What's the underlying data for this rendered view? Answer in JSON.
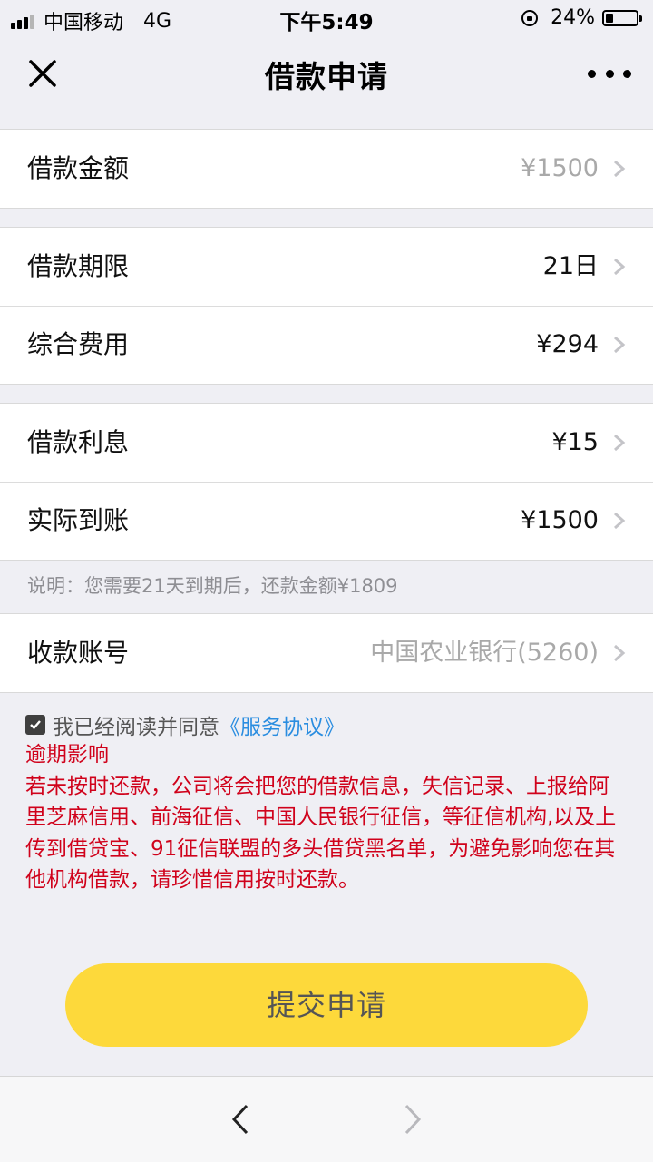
{
  "status_bar": {
    "carrier": "中国移动",
    "network": "4G",
    "time": "下午5:49",
    "battery": "24%",
    "battery_level": 0.24
  },
  "nav": {
    "title": "借款申请",
    "close_icon": "close-icon",
    "more_icon": "more-dots-icon"
  },
  "loan": {
    "amount": {
      "label": "借款金额",
      "value": "¥1500"
    },
    "term": {
      "label": "借款期限",
      "value": "21日"
    },
    "fee": {
      "label": "综合费用",
      "value": "¥294"
    },
    "interest": {
      "label": "借款利息",
      "value": "¥15"
    },
    "received": {
      "label": "实际到账",
      "value": "¥1500"
    },
    "note": "说明：您需要21天到期后，还款金额¥1809",
    "account": {
      "label": "收款账号",
      "value": "中国农业银行(5260)"
    }
  },
  "agreement": {
    "checked": true,
    "text": "我已经阅读并同意",
    "link": "《服务协议》"
  },
  "warning": {
    "title": "逾期影响",
    "body": "若未按时还款，公司将会把您的借款信息，失信记录、上报给阿里芝麻信用、前海征信、中国人民银行征信，等征信机构,以及上传到借贷宝、91征信联盟的多头借贷黑名单，为避免影响您在其他机构借款，请珍惜信用按时还款。"
  },
  "submit_label": "提交申请",
  "colors": {
    "accent": "#fdd93b",
    "warning": "#d0021b",
    "link": "#2a8de0",
    "background": "#efeff4"
  }
}
